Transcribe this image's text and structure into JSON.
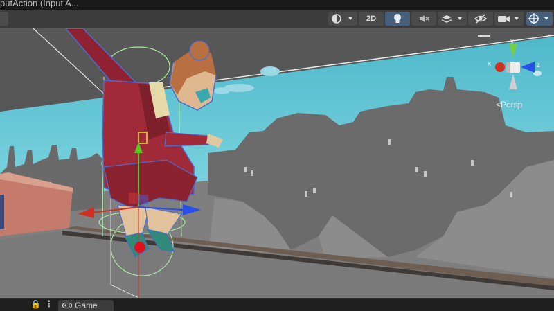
{
  "window": {
    "title": "putAction (Input A..."
  },
  "toolbar": {
    "btn_2d_label": "2D",
    "icons": [
      "draw-mode-icon",
      "lighting-icon",
      "audio-mute-icon",
      "effects-icon",
      "visibility-icon",
      "camera-icon",
      "gizmos-icon"
    ]
  },
  "scene": {
    "persp_label": "<Persp",
    "gizmo": {
      "x_label": "x",
      "y_label": "y",
      "z_label": "z"
    }
  },
  "statusbar": {
    "game_tab_label": "Game",
    "lock_symbol": "🔒",
    "menu_symbol": "⋮"
  },
  "colors": {
    "sky": "#5cc4d4",
    "city": "#6e6e6e",
    "x_axis": "#d03020",
    "y_axis": "#58c820",
    "z_axis": "#2850e8",
    "selection": "#4a6cd0",
    "character_dress": "#9a2430"
  }
}
